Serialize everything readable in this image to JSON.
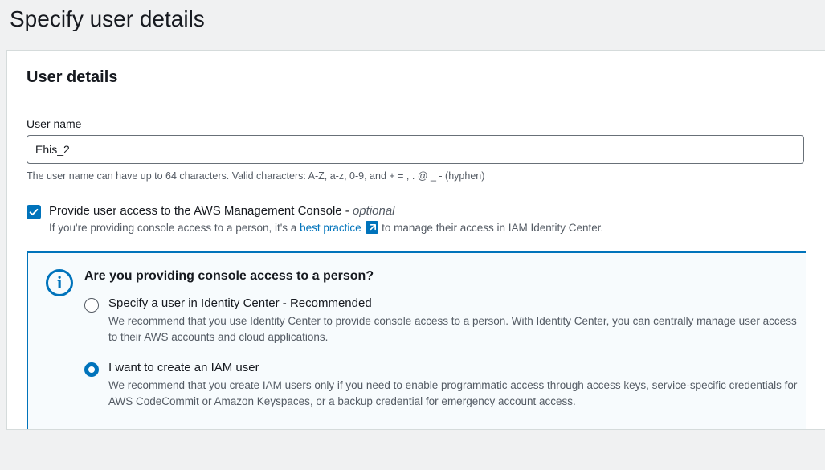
{
  "pageTitle": "Specify user details",
  "panel": {
    "title": "User details",
    "userName": {
      "label": "User name",
      "value": "Ehis_2",
      "hint": "The user name can have up to 64 characters. Valid characters: A-Z, a-z, 0-9, and + = , . @ _ - (hyphen)"
    },
    "consoleAccess": {
      "label": "Provide user access to the AWS Management Console - ",
      "optional": "optional",
      "descPrefix": "If you're providing console access to a person, it's a ",
      "linkText": "best practice",
      "descSuffix": " to manage their access in IAM Identity Center.",
      "checked": true
    }
  },
  "infoBox": {
    "title": "Are you providing console access to a person?",
    "options": [
      {
        "label": "Specify a user in Identity Center - Recommended",
        "desc": "We recommend that you use Identity Center to provide console access to a person. With Identity Center, you can centrally manage user access to their AWS accounts and cloud applications.",
        "selected": false
      },
      {
        "label": "I want to create an IAM user",
        "desc": "We recommend that you create IAM users only if you need to enable programmatic access through access keys, service-specific credentials for AWS CodeCommit or Amazon Keyspaces, or a backup credential for emergency account access.",
        "selected": true
      }
    ]
  }
}
